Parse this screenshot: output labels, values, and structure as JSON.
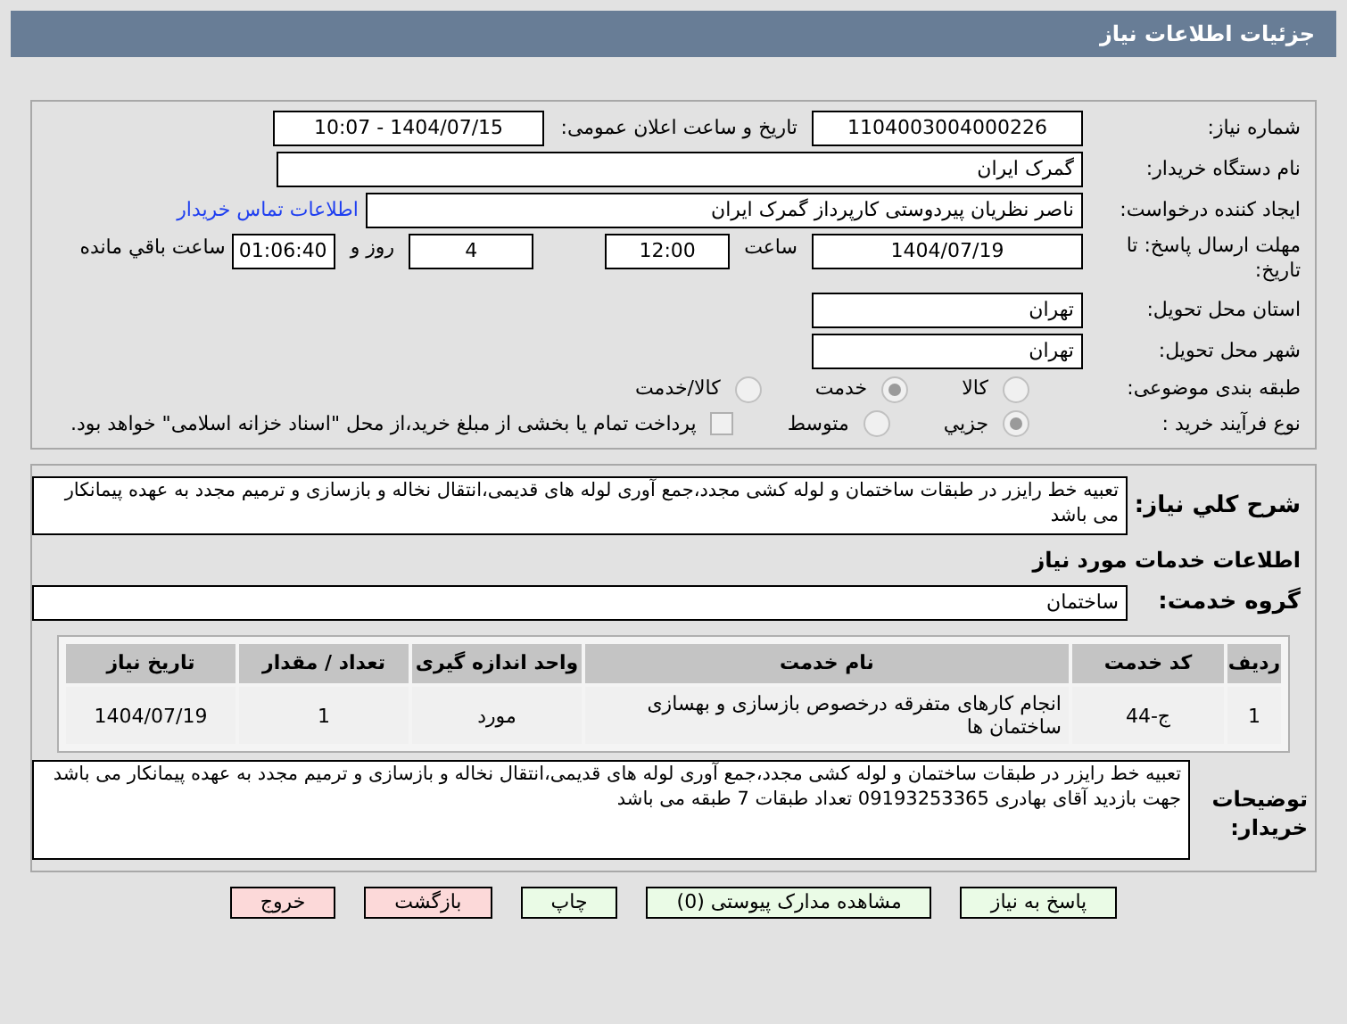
{
  "window": {
    "title": "جزئیات اطلاعات نیاز"
  },
  "need_number": {
    "label": "شماره نیاز:",
    "value": "1104003004000226"
  },
  "announce": {
    "label": "تاریخ و ساعت اعلان عمومی:",
    "value": "1404/07/15 - 10:07"
  },
  "buyer": {
    "label": "نام دستگاه خریدار:",
    "value": "گمرک ایران"
  },
  "requester": {
    "label": "ایجاد کننده درخواست:",
    "value": "ناصر نظریان پیردوستی کارپرداز گمرک ایران",
    "link": "اطلاعات تماس خریدار"
  },
  "deadline": {
    "label": "مهلت ارسال پاسخ: تا تاریخ:",
    "date": "1404/07/19",
    "time_label": "ساعت",
    "time": "12:00",
    "days": "4",
    "days_label": "روز و",
    "remaining": "01:06:40",
    "remaining_label": "ساعت باقي مانده"
  },
  "province": {
    "label": "استان محل تحویل:",
    "value": "تهران"
  },
  "city": {
    "label": "شهر محل تحویل:",
    "value": "تهران"
  },
  "category": {
    "label": "طبقه بندی موضوعی:",
    "options": [
      {
        "label": "کالا",
        "selected": false
      },
      {
        "label": "خدمت",
        "selected": true
      },
      {
        "label": "کالا/خدمت",
        "selected": false
      }
    ]
  },
  "purchase_type": {
    "label": "نوع فرآیند خرید :",
    "options": [
      {
        "label": "جزيي",
        "selected": true
      },
      {
        "label": "متوسط",
        "selected": false
      }
    ],
    "treasury": {
      "checked": false,
      "label": "پرداخت تمام یا بخشی از مبلغ خرید،از محل \"اسناد خزانه اسلامی\" خواهد بود."
    }
  },
  "summary": {
    "label": "شرح کلي نیاز:",
    "value": "تعبیه خط رایزر در  طبقات ساختمان و لوله کشی مجدد،جمع آوری لوله های قدیمی،انتقال نخاله و بازسازی و ترمیم مجدد به عهده پیمانکار می باشد"
  },
  "services_heading": "اطلاعات خدمات مورد نیاز",
  "service_group": {
    "label": "گروه خدمت:",
    "value": "ساختمان"
  },
  "table": {
    "columns": [
      "ردیف",
      "کد خدمت",
      "نام خدمت",
      "واحد اندازه گیری",
      "تعداد / مقدار",
      "تاریخ نیاز"
    ],
    "rows": [
      [
        "1",
        "ج-44",
        "انجام کارهای متفرقه درخصوص بازسازی و بهسازی ساختمان ها",
        "مورد",
        "1",
        "1404/07/19"
      ]
    ]
  },
  "buyer_notes": {
    "label": "توضیحات خریدار:",
    "value": "تعبیه خط رایزر در  طبقات ساختمان و لوله کشی مجدد،جمع آوری لوله های قدیمی،انتقال نخاله و بازسازی و ترمیم مجدد به عهده پیمانکار می باشد جهت بازدید آقای بهادری 09193253365 تعداد طبقات 7 طبقه می باشد"
  },
  "buttons": [
    {
      "label": "پاسخ به نیاز",
      "kind": "go"
    },
    {
      "label": "مشاهده مدارک پیوستی (0)",
      "kind": "go"
    },
    {
      "label": "چاپ",
      "kind": "go"
    },
    {
      "label": "بازگشت",
      "kind": "stop"
    },
    {
      "label": "خروج",
      "kind": "stop"
    }
  ]
}
